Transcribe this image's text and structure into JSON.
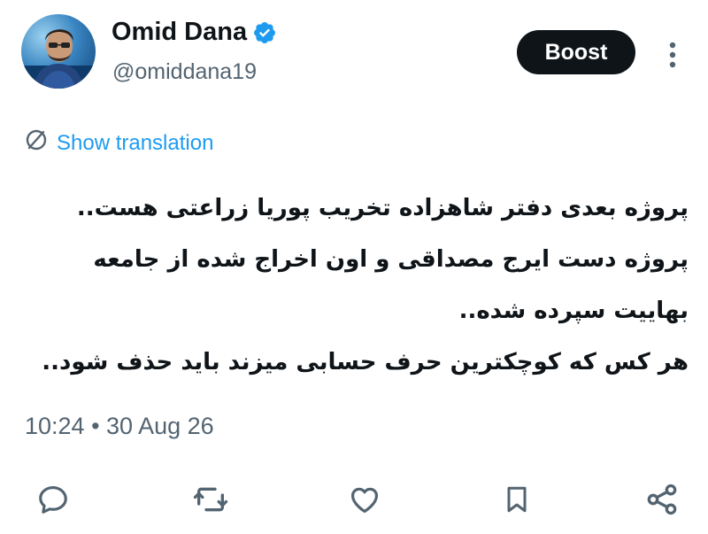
{
  "author": {
    "display_name": "Omid Dana",
    "handle": "@omiddana19",
    "verified_icon": "verified-badge-icon"
  },
  "header": {
    "boost_label": "Boost",
    "more_icon": "more-vertical-icon"
  },
  "translation": {
    "label": "Show translation",
    "icon": "translate-icon"
  },
  "tweet": {
    "lines": [
      "پروژه بعدی دفتر شاهزاده تخریب پوریا زراعتی هست..",
      "پروژه دست ایرج مصداقی و اون اخراج شده از جامعه",
      "بهاییت سپرده شده..",
      "هر کس که کوچکترین حرف حسابی میزند باید حذف شود.."
    ]
  },
  "meta": {
    "timestamp": "10:24 • 30 Aug 26"
  },
  "actions": [
    {
      "name": "reply",
      "icon": "reply-icon"
    },
    {
      "name": "repost",
      "icon": "repost-icon"
    },
    {
      "name": "like",
      "icon": "heart-icon"
    },
    {
      "name": "bookmark",
      "icon": "bookmark-icon"
    },
    {
      "name": "share",
      "icon": "share-icon"
    }
  ],
  "colors": {
    "accent": "#1d9bf0",
    "text": "#0f1419",
    "secondary": "#536471",
    "button_bg": "#0f1419"
  }
}
